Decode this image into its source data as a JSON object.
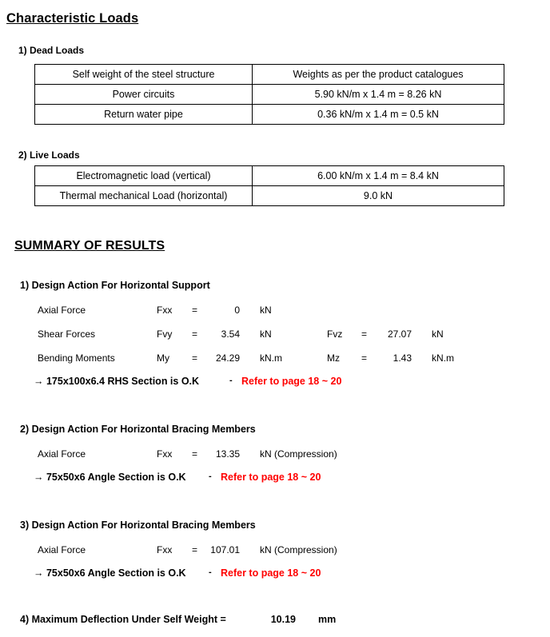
{
  "document": {
    "title": "Characteristic Loads",
    "summary_title": "SUMMARY OF RESULTS",
    "accent_red": "#ff0000",
    "text_color": "#000000",
    "background": "#ffffff"
  },
  "characteristic_loads": {
    "dead_loads": {
      "label": "1) Dead Loads",
      "rows": [
        {
          "description": "Self weight of the steel structure",
          "value": "Weights as per the product catalogues"
        },
        {
          "description": "Power circuits",
          "value": "5.90 kN/m x 1.4 m = 8.26 kN"
        },
        {
          "description": "Return water pipe",
          "value": "0.36 kN/m x 1.4 m = 0.5 kN"
        }
      ]
    },
    "live_loads": {
      "label": "2) Live Loads",
      "rows": [
        {
          "description": "Electromagnetic load (vertical)",
          "value": "6.00 kN/m x 1.4 m = 8.4 kN"
        },
        {
          "description": "Thermal mechanical Load (horizontal)",
          "value": "9.0 kN"
        }
      ]
    }
  },
  "summary_of_results": {
    "sections": [
      {
        "heading": "1) Design Action For Horizontal Support",
        "rows": [
          {
            "label": "Axial Force",
            "symbol": "Fxx",
            "equals": "=",
            "value": "0",
            "unit": "kN",
            "symbol2": "",
            "equals2": "",
            "value2": "",
            "unit2": ""
          },
          {
            "label": "Shear Forces",
            "symbol": "Fvy",
            "equals": "=",
            "value": "3.54",
            "unit": "kN",
            "symbol2": "Fvz",
            "equals2": "=",
            "value2": "27.07",
            "unit2": "kN"
          },
          {
            "label": "Bending Moments",
            "symbol": "My",
            "equals": "=",
            "value": "24.29",
            "unit": "kN.m",
            "symbol2": "Mz",
            "equals2": "=",
            "value2": "1.43",
            "unit2": "kN.m"
          }
        ],
        "conclusion": {
          "text": "→ 175x100x6.4 RHS Section is O.K",
          "dash": "-",
          "reference": "Refer to page 18 ~ 20"
        }
      },
      {
        "heading": "2) Design Action For Horizontal Bracing Members",
        "rows": [
          {
            "label": "Axial Force",
            "symbol": "Fxx",
            "equals": "=",
            "value": "13.35",
            "unit": "kN (Compression)",
            "symbol2": "",
            "equals2": "",
            "value2": "",
            "unit2": ""
          }
        ],
        "conclusion": {
          "text": "→ 75x50x6 Angle Section is O.K",
          "dash": "-",
          "reference": "Refer to page 18 ~ 20"
        }
      },
      {
        "heading": "3) Design Action For Horizontal Bracing Members",
        "rows": [
          {
            "label": "Axial Force",
            "symbol": "Fxx",
            "equals": "=",
            "value": "107.01",
            "unit": "kN (Compression)",
            "symbol2": "",
            "equals2": "",
            "value2": "",
            "unit2": ""
          }
        ],
        "conclusion": {
          "text": "→ 75x50x6 Angle Section is O.K",
          "dash": "-",
          "reference": "Refer to page 18 ~ 20"
        }
      }
    ],
    "deflection": {
      "label": "4) Maximum Deflection Under Self Weight =",
      "value": "10.19",
      "unit": "mm"
    }
  }
}
